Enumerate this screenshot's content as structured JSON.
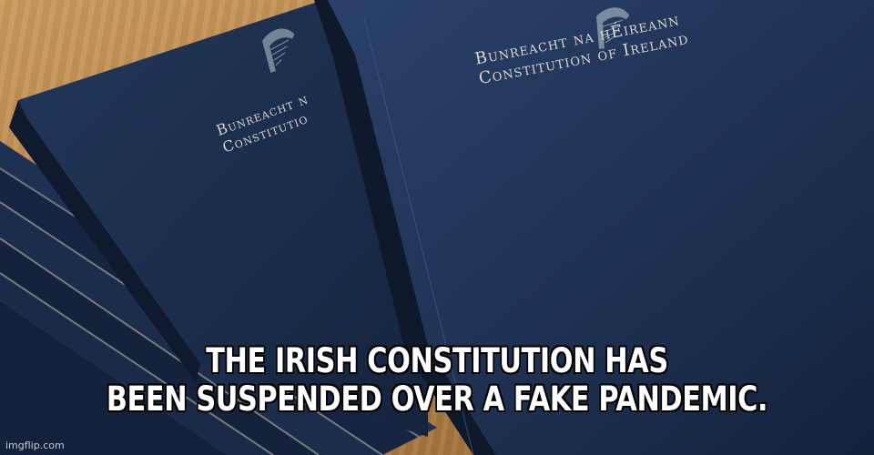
{
  "meme": {
    "caption_line1": "THE IRISH CONSTITUTION HAS",
    "caption_line2": "BEEN SUSPENDED OVER A FAKE PANDEMIC.",
    "watermark": "imgflip.com"
  },
  "books": {
    "front_title_line1": "Bunreacht na hÉireann",
    "front_title_line2": "Constitution of Ireland",
    "back_title_line1": "Bunreacht n",
    "back_title_line2": "Constitutio",
    "emblem": "harp-icon",
    "cover_color": "#1b2d4a"
  }
}
